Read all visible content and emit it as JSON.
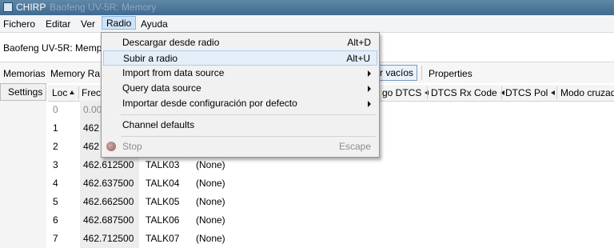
{
  "window": {
    "title": "CHIRP",
    "title_extra": "Baofeng UV-5R: Memory"
  },
  "menubar": {
    "items": [
      "Fichero",
      "Editar",
      "Ver",
      "Radio",
      "Ayuda"
    ],
    "active": "Radio"
  },
  "radio_tab": {
    "label": "Baofeng UV-5R: Memp"
  },
  "tabs": {
    "memorias": "Memorias",
    "memory_range": "Memory Ra",
    "mostrar_vacios": "r vacíos",
    "properties": "Properties"
  },
  "settings_tab": "Settings",
  "columns": {
    "loc": "Loc",
    "freq": "Frec",
    "codigo_dtcs": "go DTCS",
    "dtcs_rx": "DTCS Rx Code",
    "dtcs_pol": "DTCS Pol",
    "modo_cruzado": "Modo cruzado"
  },
  "rows": [
    {
      "loc": "0",
      "freq": "0.00",
      "name": "",
      "tone": ""
    },
    {
      "loc": "1",
      "freq": "462",
      "name": "",
      "tone": ""
    },
    {
      "loc": "2",
      "freq": "462",
      "name": "",
      "tone": ""
    },
    {
      "loc": "3",
      "freq": "462.612500",
      "name": "TALK03",
      "tone": "(None)"
    },
    {
      "loc": "4",
      "freq": "462.637500",
      "name": "TALK04",
      "tone": "(None)"
    },
    {
      "loc": "5",
      "freq": "462.662500",
      "name": "TALK05",
      "tone": "(None)"
    },
    {
      "loc": "6",
      "freq": "462.687500",
      "name": "TALK06",
      "tone": "(None)"
    },
    {
      "loc": "7",
      "freq": "462.712500",
      "name": "TALK07",
      "tone": "(None)"
    }
  ],
  "radio_menu": {
    "descargar": {
      "label": "Descargar desde radio",
      "shortcut": "Alt+D"
    },
    "subir": {
      "label": "Subir a radio",
      "shortcut": "Alt+U"
    },
    "import_ds": {
      "label": "Import from data source"
    },
    "query_ds": {
      "label": "Query data source"
    },
    "importar_config": {
      "label": "Importar desde configuración por defecto"
    },
    "channel_defaults": {
      "label": "Channel defaults"
    },
    "stop": {
      "label": "Stop",
      "shortcut": "Escape"
    }
  },
  "colors": {
    "title_bar": "#4f7a9e",
    "menu_highlight": "#cde3f6",
    "item_highlight": "#e3eef9"
  },
  "icons": [
    "app-icon",
    "stop-icon",
    "submenu-arrow-icon",
    "sort-asc-icon",
    "column-arrow-icon"
  ]
}
